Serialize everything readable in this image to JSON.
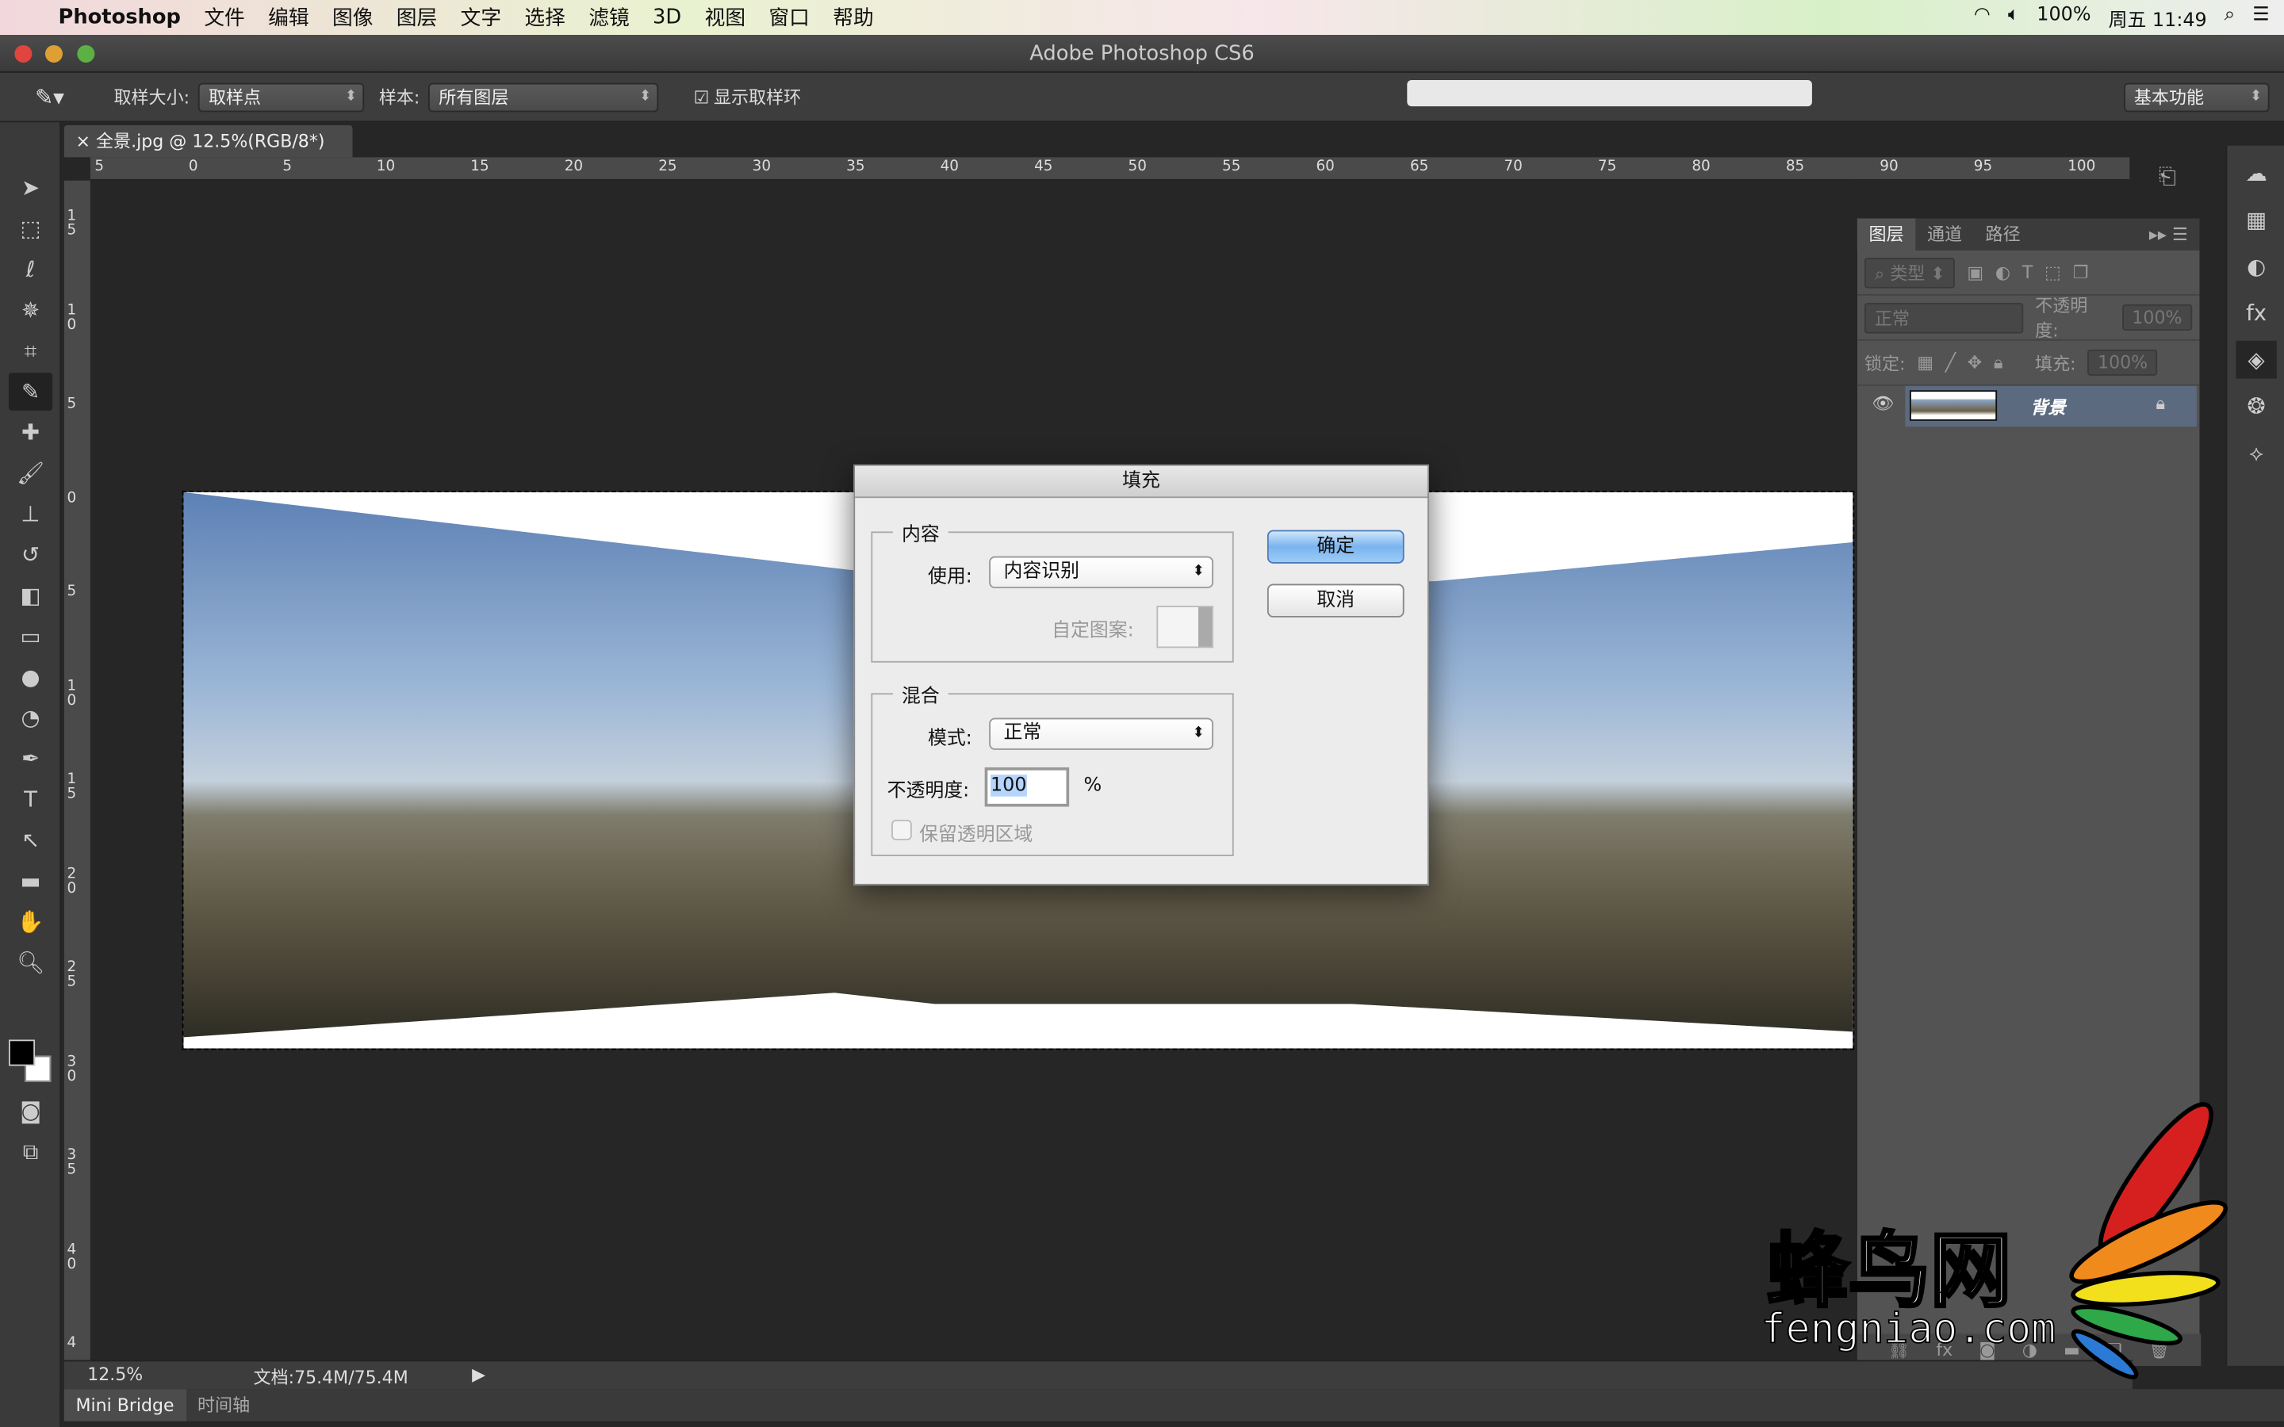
{
  "menubar": {
    "app": "Photoshop",
    "items": [
      "文件",
      "编辑",
      "图像",
      "图层",
      "文字",
      "选择",
      "滤镜",
      "3D",
      "视图",
      "窗口",
      "帮助"
    ],
    "battery": "100%",
    "clock": "周五 11:49"
  },
  "window": {
    "title": "Adobe Photoshop CS6"
  },
  "options": {
    "sample_size_label": "取样大小:",
    "sample_size_value": "取样点",
    "sample_label": "样本:",
    "sample_value": "所有图层",
    "show_ring_label": "显示取样环",
    "show_ring_checked": true,
    "workspace": "基本功能"
  },
  "document": {
    "tab": "全景.jpg @ 12.5%(RGB/8*)"
  },
  "rulers": {
    "h": [
      "5",
      "0",
      "5",
      "10",
      "15",
      "20",
      "25",
      "30",
      "35",
      "40",
      "45",
      "50",
      "55",
      "60",
      "65",
      "70",
      "75",
      "80",
      "85",
      "90",
      "95",
      "100"
    ],
    "v": [
      "15",
      "10",
      "5",
      "0",
      "5",
      "10",
      "15",
      "20",
      "25",
      "30",
      "35",
      "40",
      "4"
    ]
  },
  "dialog": {
    "title": "填充",
    "content_group": "内容",
    "use_label": "使用:",
    "use_value": "内容识别",
    "pattern_label": "自定图案:",
    "blend_group": "混合",
    "mode_label": "模式:",
    "mode_value": "正常",
    "opacity_label": "不透明度:",
    "opacity_value": "100",
    "opacity_unit": "%",
    "preserve_label": "保留透明区域",
    "preserve_checked": false,
    "ok": "确定",
    "cancel": "取消"
  },
  "layers_panel": {
    "tabs": [
      "图层",
      "通道",
      "路径"
    ],
    "filter": "类型",
    "blend": "正常",
    "opacity_label": "不透明度:",
    "opacity": "100%",
    "lock_label": "锁定:",
    "fill_label": "填充:",
    "fill": "100%",
    "layer_name": "背景"
  },
  "status": {
    "zoom": "12.5%",
    "doc": "文档:75.4M/75.4M"
  },
  "bottom_tabs": [
    "Mini Bridge",
    "时间轴"
  ],
  "watermark": {
    "cn": "蜂鸟网",
    "url": "fengniao.com"
  },
  "colors": {
    "accent": "#79b4ef",
    "layer_selected": "#5c6a80"
  }
}
